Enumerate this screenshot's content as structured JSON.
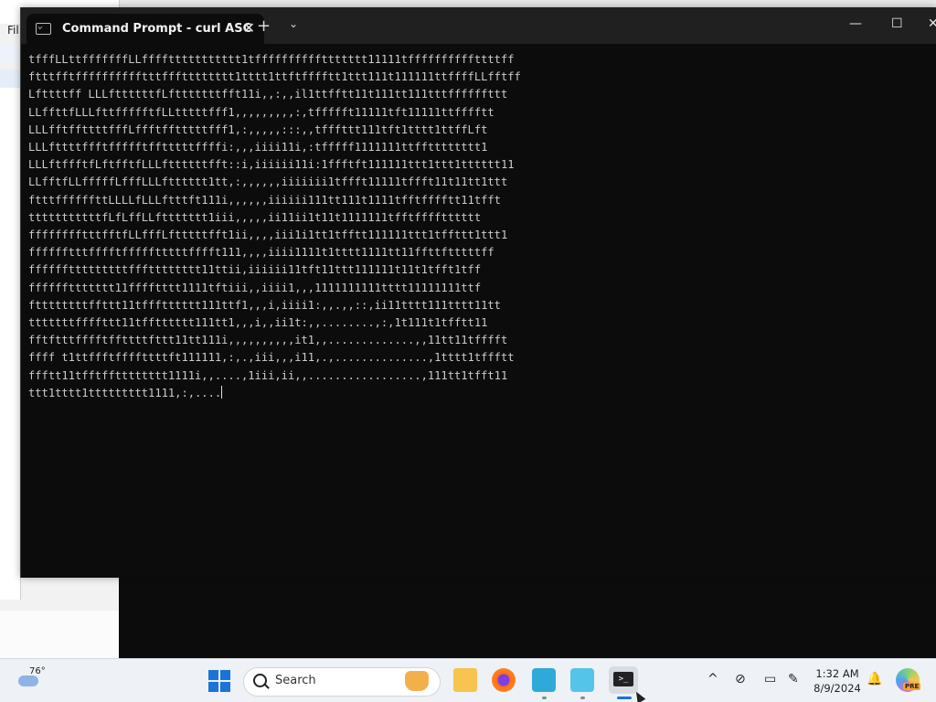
{
  "background_app": {
    "menu_label": "Fil"
  },
  "terminal": {
    "tab_title": "Command Prompt - curl  ASC",
    "tab_icon": "cmd-icon",
    "new_tab_glyph": "+",
    "dropdown_glyph": "⌄",
    "window_controls": {
      "minimize": "—",
      "maximize": "☐",
      "close": "✕"
    },
    "lines": [
      "tfffLLttfffffffLLffffttttttttttt1tffffffffffttttttt11111tffffffffffttttff",
      "ftttfftfffffffffftttffftttttttt1tttt1ttftfffftt1ttt111t111111ttffffLLfftff",
      "Lfttttff LLLfttttttfLftttttttfft11i,,:,,il1ttfftt11t111tt111tttffffffttt",
      "LLffttfLLLfttffffftfLLtttttfff1,,,,,,,,,:,tffffft11111tft11111ttfffftt",
      "LLLfftffttttfffLffftfftttttfff1,:,,,,,:::,,tfffttt111tft1tttt1ttffLft",
      "LLLfttttffftffffftfftttttffffi:,,,iiii11i,:tfffff1111111ttfftttttttt1",
      "LLLftffftfLftfftfLLLfttttttfft::i,iiiiii11i:1ffftft111111ttt1ttt1tttttt11",
      "LLfftfLLfffffLfffLLLftttttt1tt,:,,,,,,iiiiiii1tffft11111tffft11t11tt1ttt",
      "ftttffffffttLLLLfLLLftttft111i,,,,,,iiiiii111tt111t1111tfftfffftt11tfft",
      "tttttttttttfLfLffLLfttttttt1iii,,,,,ii11ii1t11t1111111tfftfffftttttt",
      "fffffffftttfftfLLfffLftttttfft1ii,,,,iii1i1tt1tfftt111111ttt1tffttt1ttt1",
      "fffffftttfffftffffftttttfffft111,,,,iiii1111t1tttt1111tt11ffttftttttff",
      "fffffftttttttttffftttttttt11ttii,iiiiii11tft11ttt111111t11t1tfft1tff",
      "ffffffttttttt11fffftttt1111tftiii,,iiii1,,,1111111111tttt11111111ttf",
      "fttttttttffttt11tffftttttt111ttf1,,,i,iiii1:,,.,,::,ii11tttt111tttt11tt",
      "tttttttffffttt11tfftttttt111tt1,,,i,,ii1t:,,........,:,1t111t1tfftt11",
      "fftftttfffftffttttfttt11tt111i,,,,,,,,,,it1,,.............,,11tt11tfffft",
      "ffff t1ttffftffffttttft111111,:,.,iii,,,i11,.,..............,1tttt1tffftt",
      "ffftt11tfftfftttttttt1111i,,....,1iii,ii,,.................,111tt1tfft11",
      "ttt1tttt1ttttttttt1111,:,...."
    ]
  },
  "taskbar": {
    "weather_temp": "76°",
    "search_placeholder": "Search",
    "time": "1:32 AM",
    "date": "8/9/2024",
    "copilot_badge": "PRE",
    "tray": {
      "chevron": "^",
      "network": "⊘",
      "display": "▭",
      "pen": "✎",
      "bell": "🔔"
    }
  }
}
